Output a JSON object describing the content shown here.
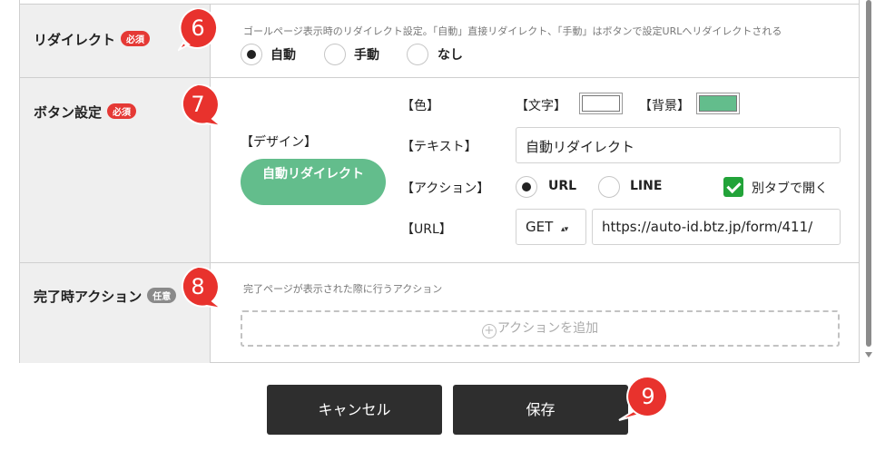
{
  "redirect": {
    "label": "リダイレクト",
    "badge": "必須",
    "description": "ゴールページ表示時のリダイレクト設定。「自動」直接リダイレクト、「手動」はボタンで設定URLへリダイレクトされる",
    "options": [
      {
        "label": "自動",
        "selected": true
      },
      {
        "label": "手動",
        "selected": false
      },
      {
        "label": "なし",
        "selected": false
      }
    ]
  },
  "button_settings": {
    "label": "ボタン設定",
    "badge": "必須",
    "design_label": "【デザイン】",
    "design_button_text": "自動リダイレクト",
    "color_label": "【色】",
    "text_color_label": "【文字】",
    "text_color": "#ffffff",
    "bg_color_label": "【背景】",
    "bg_color": "#63bd8c",
    "text_label": "【テキスト】",
    "text_value": "自動リダイレクト",
    "action_label": "【アクション】",
    "action_options": [
      {
        "label": "URL",
        "selected": true
      },
      {
        "label": "LINE",
        "selected": false
      }
    ],
    "new_tab_label": "別タブで開く",
    "new_tab_checked": true,
    "url_label": "【URL】",
    "method_value": "GET",
    "method_arrows": "▴▾",
    "url_value": "https://auto-id.btz.jp/form/411/"
  },
  "completion_action": {
    "label": "完了時アクション",
    "badge": "任意",
    "description": "完了ページが表示された際に行うアクション",
    "add_label": "アクションを追加",
    "add_icon": "+"
  },
  "footer": {
    "cancel_label": "キャンセル",
    "save_label": "保存"
  },
  "markers": [
    "6",
    "7",
    "8",
    "9"
  ],
  "colors": {
    "marker_red": "#e8322d",
    "badge_red": "#e53935",
    "accent_green": "#63bd8c",
    "check_green": "#22a339",
    "dark_button": "#2e2e2e"
  }
}
